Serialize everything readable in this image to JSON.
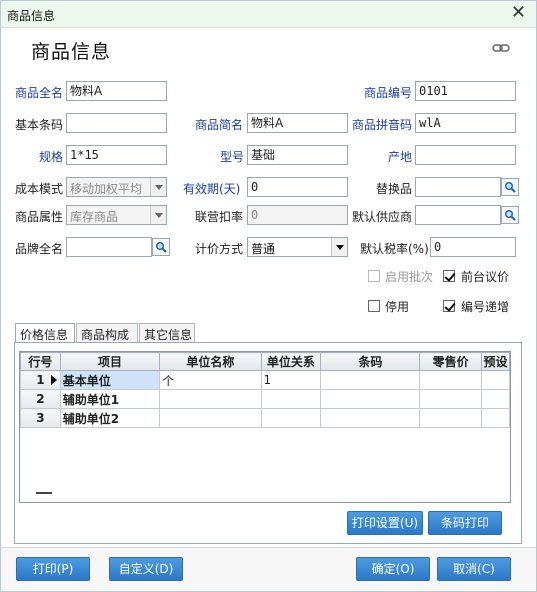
{
  "window": {
    "title": "商品信息",
    "close_glyph": "✕"
  },
  "form": {
    "heading": "商品信息",
    "labels": {
      "full_name": "商品全名",
      "code": "商品编号",
      "barcode": "基本条码",
      "short_name": "商品简名",
      "pinyin": "商品拼音码",
      "spec": "规格",
      "model": "型号",
      "origin": "产地",
      "cost_mode": "成本模式",
      "validity": "有效期(天)",
      "substitute": "替换品",
      "attribute": "商品属性",
      "deduct_rate": "联营扣率",
      "default_supplier": "默认供应商",
      "brand": "品牌全名",
      "pricing": "计价方式",
      "tax_rate": "默认税率(%)"
    },
    "values": {
      "full_name": "物料A",
      "code": "0101",
      "barcode": "",
      "short_name": "物料A",
      "pinyin": "wlA",
      "spec": "1*15",
      "model": "基础",
      "origin": "",
      "cost_mode": "移动加权平均",
      "validity": "0",
      "substitute": "",
      "attribute": "库存商品",
      "deduct_rate": "0",
      "default_supplier": "",
      "brand": "",
      "pricing": "普通",
      "tax_rate": "0"
    },
    "checkboxes": {
      "batch": {
        "label": "启用批次",
        "checked": false,
        "enabled": false
      },
      "counter_price": {
        "label": "前台议价",
        "checked": true,
        "enabled": true
      },
      "disabled": {
        "label": "停用",
        "checked": false,
        "enabled": true
      },
      "auto_increment": {
        "label": "编号递增",
        "checked": true,
        "enabled": true
      }
    }
  },
  "tabs": [
    {
      "label": "价格信息",
      "active": true
    },
    {
      "label": "商品构成",
      "active": false
    },
    {
      "label": "其它信息",
      "active": false
    }
  ],
  "grid": {
    "columns": [
      "行号",
      "项目",
      "单位名称",
      "单位关系",
      "条码",
      "零售价",
      "预设"
    ],
    "rows": [
      {
        "num": "1",
        "item": "基本单位",
        "unit": "个",
        "relation": "1",
        "barcode": "",
        "retail": "",
        "preset": ""
      },
      {
        "num": "2",
        "item": "辅助单位1",
        "unit": "",
        "relation": "",
        "barcode": "",
        "retail": "",
        "preset": ""
      },
      {
        "num": "3",
        "item": "辅助单位2",
        "unit": "",
        "relation": "",
        "barcode": "",
        "retail": "",
        "preset": ""
      }
    ]
  },
  "panel_buttons": {
    "print_settings": "打印设置(U)",
    "barcode_print": "条码打印"
  },
  "footer_buttons": {
    "print": "打印(P)",
    "customize": "自定义(D)",
    "ok": "确定(O)",
    "cancel": "取消(C)"
  },
  "colors": {
    "accent": "#2b78c8",
    "label_blue": "#1a3fa0",
    "title_bar": "#eef7ee"
  }
}
